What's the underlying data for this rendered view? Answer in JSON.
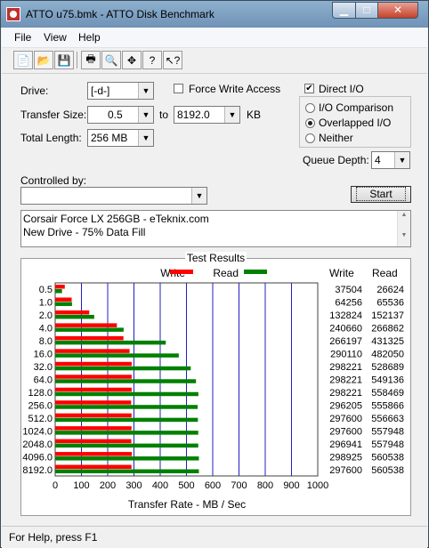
{
  "window": {
    "title": "ATTO u75.bmk - ATTO Disk Benchmark"
  },
  "menu": [
    "File",
    "View",
    "Help"
  ],
  "toolbar_icons": [
    "new-icon",
    "open-icon",
    "save-icon",
    "print-icon",
    "print-preview-icon",
    "move-icon",
    "help-icon",
    "context-help-icon"
  ],
  "form": {
    "drive_label": "Drive:",
    "drive_value": "[-d-]",
    "force_write_label": "Force Write Access",
    "force_write_checked": false,
    "direct_io_label": "Direct I/O",
    "direct_io_checked": true,
    "transfer_size_label": "Transfer Size:",
    "transfer_size_from": "0.5",
    "to_label": "to",
    "transfer_size_to": "8192.0",
    "kb_label": "KB",
    "total_length_label": "Total Length:",
    "total_length_value": "256 MB",
    "io_comparison_label": "I/O Comparison",
    "overlapped_io_label": "Overlapped I/O",
    "neither_label": "Neither",
    "selected_mode": "Overlapped I/O",
    "queue_depth_label": "Queue Depth:",
    "queue_depth_value": "4",
    "controlled_by_label": "Controlled by:",
    "controlled_by_value": "",
    "start_label": "Start",
    "notes": [
      "Corsair Force LX 256GB - eTeknix.com",
      "New Drive - 75% Data Fill"
    ]
  },
  "results": {
    "title": "Test Results",
    "write_legend": "Write",
    "read_legend": "Read",
    "write_header": "Write",
    "read_header": "Read",
    "write_color": "#ff0000",
    "read_color": "#008000"
  },
  "chart_data": {
    "type": "bar",
    "orientation": "horizontal",
    "categories": [
      "0.5",
      "1.0",
      "2.0",
      "4.0",
      "8.0",
      "16.0",
      "32.0",
      "64.0",
      "128.0",
      "256.0",
      "512.0",
      "1024.0",
      "2048.0",
      "4096.0",
      "8192.0"
    ],
    "series": [
      {
        "name": "Write",
        "values": [
          37504,
          64256,
          132824,
          240660,
          266197,
          290110,
          298221,
          298221,
          298221,
          296205,
          297600,
          297600,
          296941,
          298925,
          297600
        ]
      },
      {
        "name": "Read",
        "values": [
          26624,
          65536,
          152137,
          266862,
          431325,
          482050,
          528689,
          549136,
          558469,
          555866,
          556663,
          557948,
          557948,
          560538,
          560538
        ]
      }
    ],
    "xlabel": "Transfer Rate - MB / Sec",
    "xlim": [
      0,
      1000
    ],
    "xticks": [
      "0",
      "100",
      "200",
      "300",
      "400",
      "500",
      "600",
      "700",
      "800",
      "900",
      "1000"
    ],
    "grid": true,
    "legend": "top"
  },
  "status": {
    "text": "For Help, press F1"
  }
}
